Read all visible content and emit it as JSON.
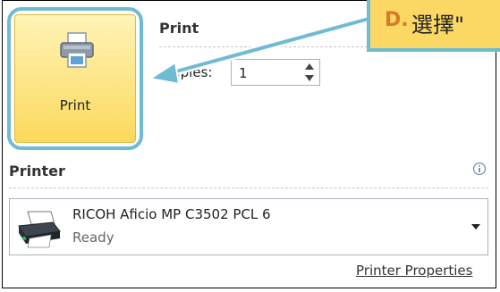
{
  "print_button": {
    "label": "Print",
    "icon": "printer-icon"
  },
  "print_section": {
    "title": "Print"
  },
  "copies": {
    "label": "Copies:",
    "value": "1"
  },
  "callout": {
    "letter": "D.",
    "text": "選擇\"",
    "arrow_color": "#6fbbd3",
    "bg_color": "#fbd764"
  },
  "printer_section": {
    "title": "Printer",
    "info_icon": "info-icon",
    "selected_printer": {
      "name": "RICOH Aficio MP C3502 PCL 6",
      "status": "Ready"
    },
    "properties_link": "Printer Properties"
  },
  "colors": {
    "accent_outline": "#6fbbd3",
    "button_gradient_top": "#fff4b6",
    "button_gradient_bottom": "#fbd95c"
  }
}
